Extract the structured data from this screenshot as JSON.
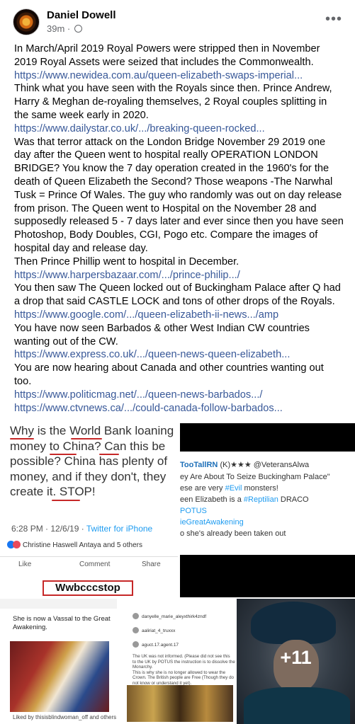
{
  "post": {
    "author": "Daniel Dowell",
    "time": "39m",
    "separator": "·",
    "more_icon": "•••",
    "body_lines": [
      {
        "text": "In March/April 2019 Royal Powers were stripped then in November",
        "link": false
      },
      {
        "text": "2019 Royal Assets were seized that includes the Commonwealth.",
        "link": false
      },
      {
        "text": "https://www.newidea.com.au/queen-elizabeth-swaps-imperial...",
        "link": true
      },
      {
        "text": "Think what you have seen with the Royals since then. Prince Andrew,",
        "link": false
      },
      {
        "text": "Harry & Meghan de-royaling themselves, 2 Royal couples splitting in",
        "link": false
      },
      {
        "text": "the same week early in 2020.",
        "link": false
      },
      {
        "text": "https://www.dailystar.co.uk/.../breaking-queen-rocked...",
        "link": true
      },
      {
        "text": "Was that terror attack on the London Bridge November 29 2019 one",
        "link": false
      },
      {
        "text": "day after the Queen went to hospital really OPERATION LONDON",
        "link": false
      },
      {
        "text": "BRIDGE? You know the 7 day operation created in the 1960's for the",
        "link": false
      },
      {
        "text": "death of Queen Elizabeth the Second?  Those weapons -The Narwhal",
        "link": false
      },
      {
        "text": "Tusk = Prince Of Wales. The guy who randomly was out on day release",
        "link": false
      },
      {
        "text": "from prison. The Queen went to Hospital on the November 28 and",
        "link": false
      },
      {
        "text": "supposedly released 5 - 7 days later and ever since then you have seen",
        "link": false
      },
      {
        "text": "Photoshop, Body Doubles, CGI, Pogo etc. Compare the images of",
        "link": false
      },
      {
        "text": "hospital day and release day.",
        "link": false
      },
      {
        "text": "Then Prince Phillip went to hospital in December.",
        "link": false
      },
      {
        "text": "https://www.harpersbazaar.com/.../prince-philip.../",
        "link": true
      },
      {
        "text": "You then saw The Queen locked out of Buckingham Palace after Q had",
        "link": false
      },
      {
        "text": "a drop that said CASTLE LOCK and tons of other drops of the Royals.",
        "link": false
      },
      {
        "text": "https://www.google.com/.../queen-elizabeth-ii-news.../amp",
        "link": true
      },
      {
        "text": "You have now seen Barbados & other West Indian CW countries",
        "link": false
      },
      {
        "text": "wanting out of the CW.",
        "link": false
      },
      {
        "text": "https://www.express.co.uk/.../queen-news-queen-elizabeth...",
        "link": true
      },
      {
        "text": "You are now hearing about Canada and other countries wanting out",
        "link": false
      },
      {
        "text": "too.",
        "link": false
      },
      {
        "text": "https://www.politicmag.net/.../queen-news-barbados.../",
        "link": true
      },
      {
        "text": "https://www.ctvnews.ca/.../could-canada-follow-barbados...",
        "link": true
      }
    ],
    "colors": {
      "link": "#385898",
      "text": "#050505",
      "meta": "#65676b"
    }
  },
  "photos": {
    "tweet1": {
      "lines": [
        "Why is the World Bank loaning",
        "money to China? Can this be",
        "possible? China has plenty of",
        "money, and if they don't, they",
        "create it. STOP!"
      ],
      "time": "6:28 PM · 12/6/19 · ",
      "via": "Twitter for iPhone",
      "reactions": "Christine Haswell Antaya and 5 others",
      "like": "Like",
      "comment": "Comment",
      "share": "Share",
      "stop_label": "Wwbcccstop"
    },
    "tweet2": {
      "handle": "TooTallRN",
      "handle_suffix": "(K)★★★ @VeteransAlwa",
      "line1": "ey Are About To Seize Buckingham Palace\"",
      "line2a": "ese are very ",
      "line2b": "#Evil",
      "line2c": " monsters!",
      "line3a": "een Elizabeth is a ",
      "line3b": "#Reptilian",
      "line3c": " DRACO",
      "line4": "POTUS",
      "line5": "ieGreatAwakening",
      "line6": "o she's already been taken out"
    },
    "post3": {
      "lines": [
        "She is now a Vassal to the Great",
        "Awakening."
      ],
      "footer": "Liked by thisisblindwoman_off and others"
    },
    "post4": {
      "user1": "danyelle_marie_aleyxthirk4zndf",
      "user2": "aaliriat_4_truxxx",
      "user3": "aguct.17.agent.17",
      "body": [
        "The UK was not informed. (Please did not see this",
        "to the UK by POTUS the instruction is to dissolve the",
        "Monarchy.",
        "This is why she is no longer allowed to wear the",
        "Crown. The British people are Free (Though they do",
        "not know or understand it yet)."
      ]
    },
    "more_count": "+11"
  }
}
